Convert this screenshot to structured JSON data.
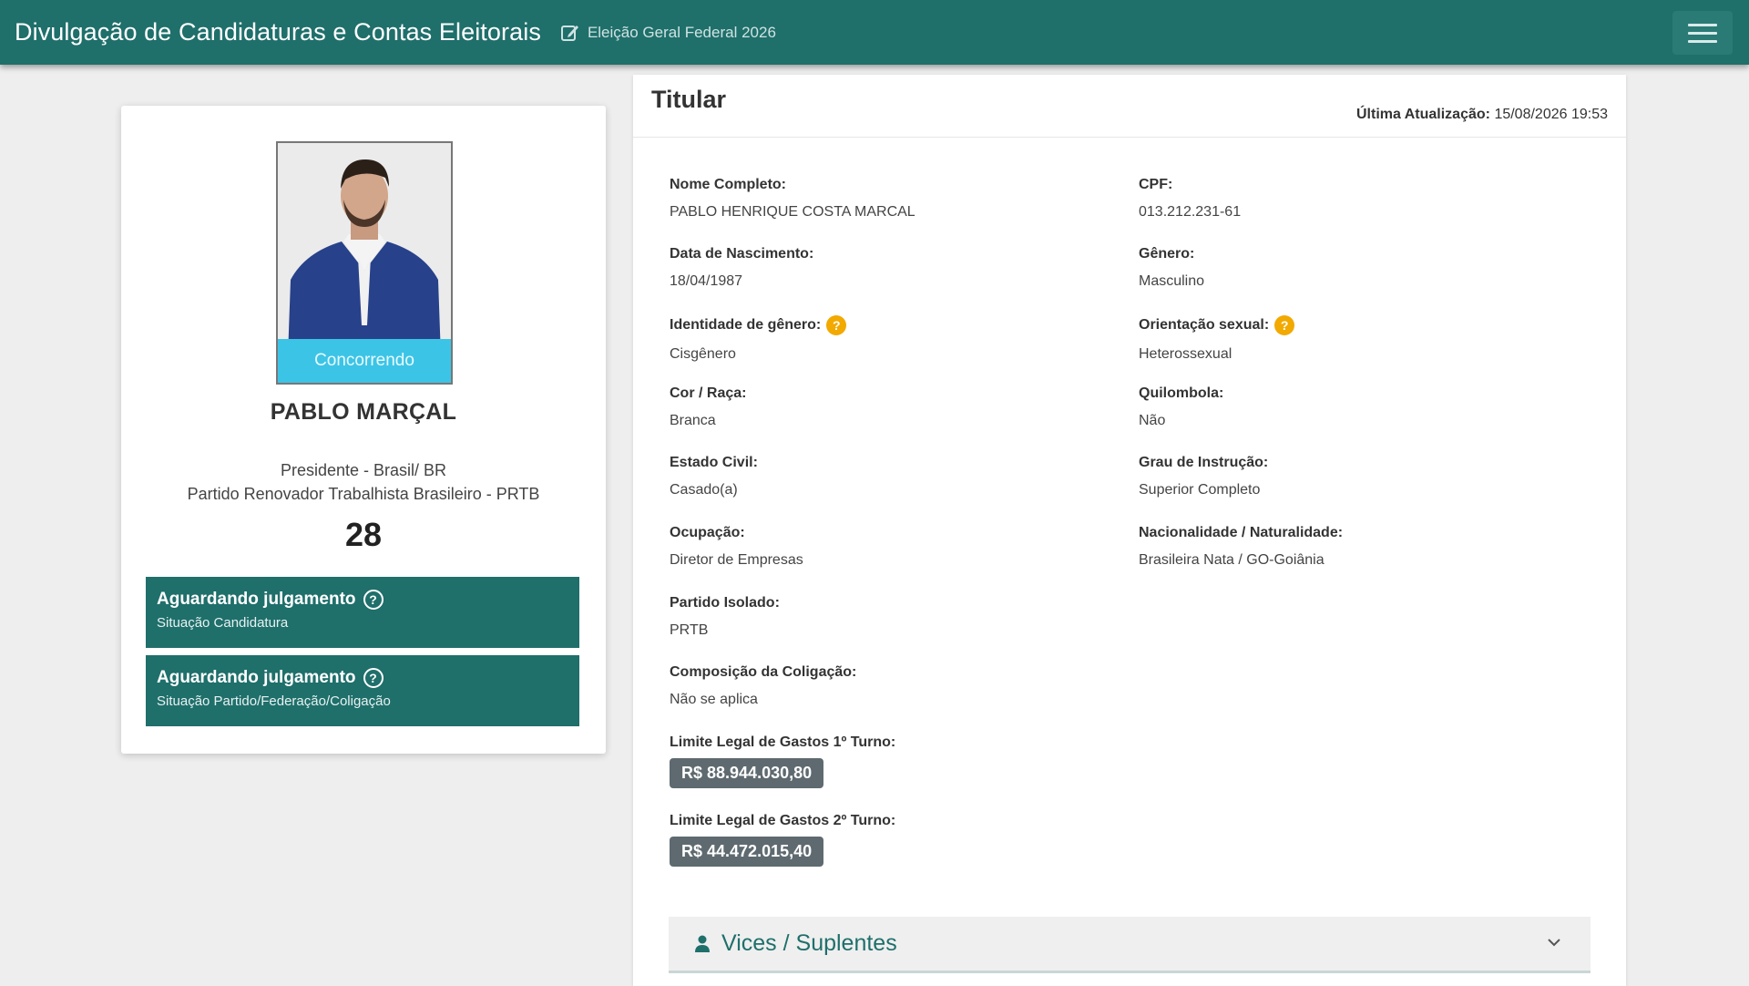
{
  "header": {
    "title": "Divulgação de Candidaturas e Contas Eleitorais",
    "election": "Eleição Geral Federal 2026",
    "icons": {
      "edit": "edit-icon",
      "menu": "hamburger-menu-icon"
    }
  },
  "candidate": {
    "photo_badge": "Concorrendo",
    "name": "PABLO MARÇAL",
    "office": "Presidente - Brasil/ BR",
    "party": "Partido Renovador Trabalhista Brasileiro - PRTB",
    "number": "28",
    "status": [
      {
        "title": "Aguardando julgamento",
        "subtitle": "Situação Candidatura"
      },
      {
        "title": "Aguardando julgamento",
        "subtitle": "Situação Partido/Federação/Coligação"
      }
    ]
  },
  "titular": {
    "title": "Titular",
    "last_update_label": "Última Atualização:",
    "last_update_value": "15/08/2026 19:53",
    "fields": {
      "nome_completo": {
        "label": "Nome Completo:",
        "value": "PABLO HENRIQUE COSTA MARCAL"
      },
      "cpf": {
        "label": "CPF:",
        "value": "013.212.231-61"
      },
      "nascimento": {
        "label": "Data de Nascimento:",
        "value": "18/04/1987"
      },
      "genero": {
        "label": "Gênero:",
        "value": "Masculino"
      },
      "identidade_genero": {
        "label": "Identidade de gênero:",
        "value": "Cisgênero"
      },
      "orientacao": {
        "label": "Orientação sexual:",
        "value": "Heterossexual"
      },
      "cor_raca": {
        "label": "Cor / Raça:",
        "value": "Branca"
      },
      "quilombola": {
        "label": "Quilombola:",
        "value": "Não"
      },
      "estado_civil": {
        "label": "Estado Civil:",
        "value": "Casado(a)"
      },
      "instrucao": {
        "label": "Grau de Instrução:",
        "value": "Superior Completo"
      },
      "ocupacao": {
        "label": "Ocupação:",
        "value": "Diretor de Empresas"
      },
      "nacionalidade": {
        "label": "Nacionalidade / Naturalidade:",
        "value": "Brasileira Nata / GO-Goiânia"
      },
      "partido_isolado": {
        "label": "Partido Isolado:",
        "value": "PRTB"
      },
      "coligacao": {
        "label": "Composição da Coligação:",
        "value": "Não se aplica"
      },
      "limite_1": {
        "label": "Limite Legal de Gastos 1º Turno:",
        "value": "R$ 88.944.030,80"
      },
      "limite_2": {
        "label": "Limite Legal de Gastos 2º Turno:",
        "value": "R$ 44.472.015,40"
      }
    },
    "warn_icon_glyph": "?"
  },
  "vices": {
    "label": "Vices / Suplentes"
  },
  "colors": {
    "primary": "#1f6f6b",
    "badge": "#3cc4e6",
    "chip": "#5e6a70",
    "warn": "#f2a900"
  }
}
